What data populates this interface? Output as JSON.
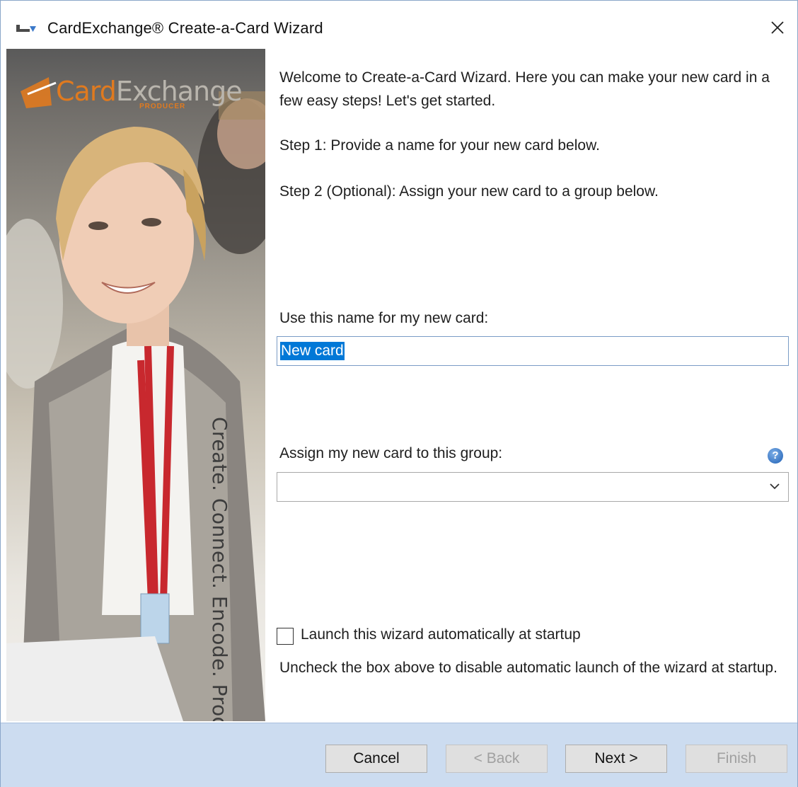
{
  "window": {
    "title": "CardExchange® Create-a-Card Wizard",
    "close_icon": "close-icon"
  },
  "side_panel": {
    "logo_part1": "Card",
    "logo_part2": "Exchange",
    "logo_subtitle": "PRODUCER",
    "vertical_tagline": "Create. Connect. Encode. Produce"
  },
  "content": {
    "intro": "Welcome to Create-a-Card Wizard. Here you can make your new card in a few easy steps! Let's get started.",
    "step1": "Step 1:  Provide a name for your new card below.",
    "step2": "Step 2 (Optional):  Assign your new card to a group below.",
    "name_label": "Use this name for my new card:",
    "name_value": "New card",
    "group_label": "Assign my new card to this group:",
    "group_value": "",
    "help_icon_glyph": "?",
    "launch_checkbox_label": "Launch this wizard automatically at startup",
    "launch_checked": false,
    "note": "Uncheck the box above to disable automatic launch of the wizard at startup."
  },
  "footer": {
    "cancel": "Cancel",
    "back": "< Back",
    "next": "Next >",
    "finish": "Finish"
  },
  "colors": {
    "footer_bg": "#ccdcf0",
    "selection": "#0078d7",
    "logo_orange": "#e07a1f"
  }
}
